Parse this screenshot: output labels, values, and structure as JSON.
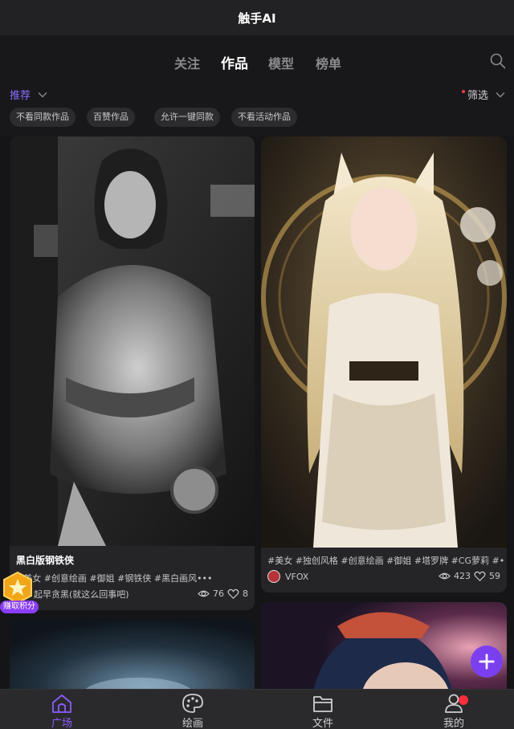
{
  "app": {
    "title": "触手AI"
  },
  "tabs": [
    {
      "label": "关注",
      "active": false
    },
    {
      "label": "作品",
      "active": true
    },
    {
      "label": "模型",
      "active": false
    },
    {
      "label": "榜单",
      "active": false
    }
  ],
  "filters": {
    "sort_label": "推荐",
    "filter_label": "筛选"
  },
  "chips": [
    "不看同款作品",
    "百赞作品",
    "允许一键同款",
    "不看活动作品"
  ],
  "cards": [
    {
      "title": "黑白版钢铁侠",
      "tags": "#美女 #创意绘画 #御姐 #钢铁侠 #黑白画风•••",
      "user": "起早贪黑(就这么回事吧)",
      "views": "76",
      "likes": "8",
      "palette": {
        "bg": "#2b2b2b",
        "subject": "#9a9a9a"
      }
    },
    {
      "title": "",
      "tags": "#美女 #独创风格 #创意绘画 #御姐 #塔罗牌 #CG萝莉 #•••",
      "user": "VFOX",
      "views": "423",
      "likes": "59",
      "palette": {
        "bg": "#3a3226",
        "subject": "#e8dcc4"
      }
    }
  ],
  "badge": {
    "label": "赚取积分"
  },
  "bottom_nav": [
    {
      "label": "广场",
      "icon": "home-icon",
      "active": true
    },
    {
      "label": "绘画",
      "icon": "palette-icon",
      "active": false
    },
    {
      "label": "文件",
      "icon": "folder-icon",
      "active": false
    },
    {
      "label": "我的",
      "icon": "user-icon",
      "active": false
    }
  ],
  "colors": {
    "accent": "#8b5cff",
    "notification": "#ff2d3a",
    "background": "#151517"
  }
}
